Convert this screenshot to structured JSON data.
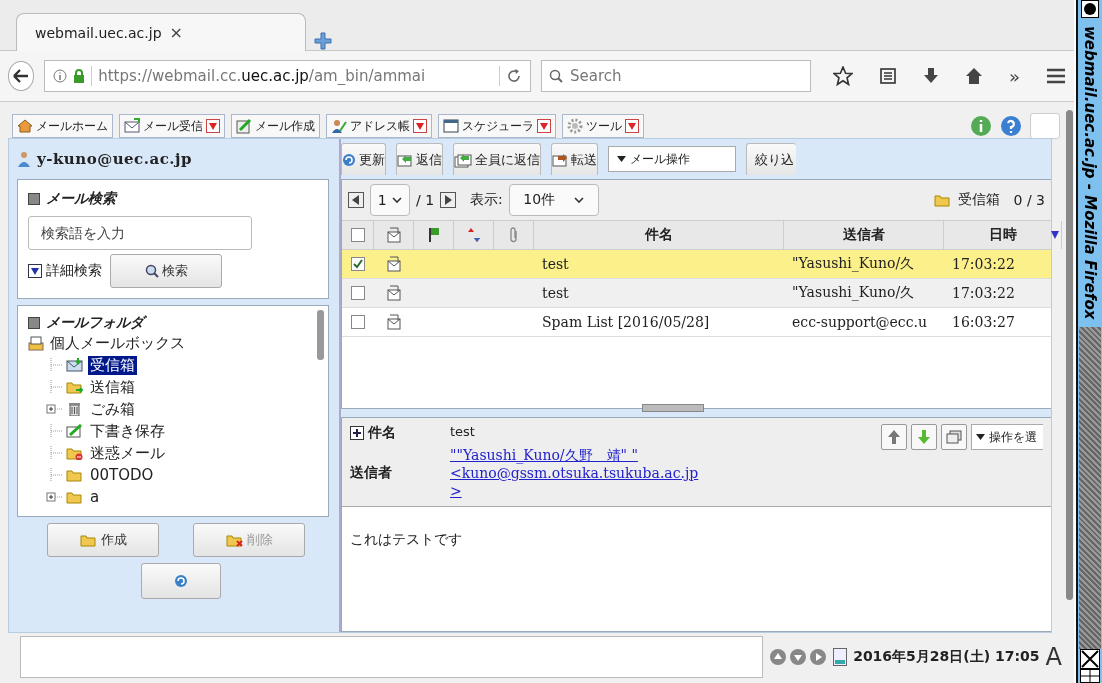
{
  "window_title": "webmail.uec.ac.jp - Mozilla Firefox",
  "browser": {
    "tab_title": "webmail.uec.ac.jp",
    "tab_close": "×",
    "url": "https://webmail.cc.**uec.ac.jp**/am_bin/ammai",
    "search_placeholder": "Search",
    "overflow": "»"
  },
  "menu": [
    {
      "label": "メールホーム",
      "kind": "home",
      "has_dropdown": false
    },
    {
      "label": "メール受信",
      "kind": "receive",
      "has_dropdown": true
    },
    {
      "label": "メール作成",
      "kind": "compose",
      "has_dropdown": false
    },
    {
      "label": "アドレス帳",
      "kind": "address",
      "has_dropdown": true
    },
    {
      "label": "スケジューラ",
      "kind": "schedule",
      "has_dropdown": true
    },
    {
      "label": "ツール",
      "kind": "tools",
      "has_dropdown": true
    }
  ],
  "account": "y-kuno@uec.ac.jp",
  "search": {
    "title": "メール検索",
    "placeholder": "検索語を入力",
    "advanced": "詳細検索",
    "button": "検索"
  },
  "folders": {
    "title": "メールフォルダ",
    "tree": [
      {
        "label": "個人メールボックス",
        "kind": "mailbox",
        "selected": false,
        "children": [
          {
            "label": "受信箱",
            "kind": "inbox",
            "collapsed": false,
            "selected": true
          },
          {
            "label": "送信箱",
            "kind": "outbox",
            "collapsed": false,
            "selected": false
          },
          {
            "label": "ごみ箱",
            "kind": "trash",
            "collapsed": true,
            "selected": false
          },
          {
            "label": "下書き保存",
            "kind": "draft",
            "collapsed": false,
            "selected": false
          },
          {
            "label": "迷惑メール",
            "kind": "spam",
            "collapsed": false,
            "selected": false
          },
          {
            "label": "00TODO",
            "kind": "folder",
            "collapsed": false,
            "selected": false
          },
          {
            "label": "a",
            "kind": "folder",
            "collapsed": true,
            "selected": false
          }
        ]
      }
    ]
  },
  "folder_buttons": [
    {
      "label": "作成",
      "kind": "create",
      "disabled": false
    },
    {
      "label": "削除",
      "kind": "delete",
      "disabled": true
    }
  ],
  "toolbar": [
    {
      "label": "更新",
      "kind": "refresh"
    },
    {
      "label": "返信",
      "kind": "reply"
    },
    {
      "label": "全員に返信",
      "kind": "reply-all"
    },
    {
      "label": "転送",
      "kind": "forward"
    }
  ],
  "mail_action": "メール操作",
  "filter_button": "絞り込",
  "pager": {
    "page": "1",
    "total": "/ 1",
    "show_label": "表示:",
    "per_page": "10件",
    "folder": "受信箱",
    "count": "0 / 3"
  },
  "columns": [
    {
      "kind": "select",
      "checked": false
    },
    {
      "kind": "read"
    },
    {
      "kind": "flag"
    },
    {
      "kind": "priority"
    },
    {
      "kind": "attachment"
    },
    {
      "kind": "text",
      "label": "件名",
      "sorted": false
    },
    {
      "kind": "text",
      "label": "送信者",
      "sorted": false
    },
    {
      "kind": "text",
      "label": "日時",
      "sorted": true
    }
  ],
  "messages": [
    {
      "checked": true,
      "selected": true,
      "subject": "test",
      "sender": "\"Yasushi_Kuno/久",
      "time": "17:03:22"
    },
    {
      "checked": false,
      "selected": false,
      "subject": "test",
      "sender": "\"Yasushi_Kuno/久",
      "time": "17:03:22"
    },
    {
      "checked": false,
      "selected": false,
      "subject": "Spam List [2016/05/28]",
      "sender": "ecc-support@ecc.u",
      "time": "16:03:27"
    }
  ],
  "preview": {
    "subject_label": "件名",
    "subject": "test",
    "sender_label": "送信者",
    "sender_lines": [
      "\"\"Yasushi_Kuno/久野　靖\" \"",
      "<kuno@gssm.otsuka.tsukuba.ac.jp",
      ">"
    ],
    "action": "操作を選",
    "body": "これはテストです"
  },
  "status": {
    "date": "2016年5月28日(土) 17:05",
    "extra": "A"
  }
}
